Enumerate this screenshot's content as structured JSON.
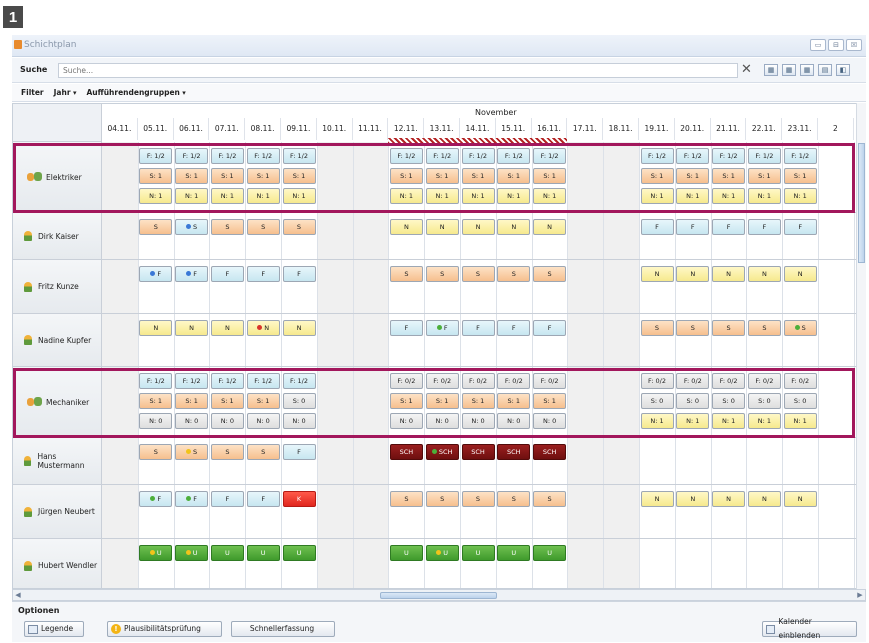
{
  "badge": "1",
  "window": {
    "title": "Schichtplan",
    "buttons": [
      "▭",
      "⊟",
      "☒"
    ]
  },
  "search": {
    "label": "Suche",
    "placeholder": "Suche...",
    "clear": "✕",
    "icons": [
      "▦",
      "▦",
      "▦",
      "▤",
      "◧"
    ]
  },
  "filter": {
    "label": "Filter",
    "year": "Jahr",
    "groups": "Aufführendengruppen"
  },
  "month": "November",
  "days": [
    "04.11.",
    "05.11.",
    "06.11.",
    "07.11.",
    "08.11.",
    "09.11.",
    "10.11.",
    "11.11.",
    "12.11.",
    "13.11.",
    "14.11.",
    "15.11.",
    "16.11.",
    "17.11.",
    "18.11.",
    "19.11.",
    "20.11.",
    "21.11.",
    "22.11.",
    "23.11.",
    "2"
  ],
  "rows": [
    {
      "name": "Elektriker",
      "kind": "group"
    },
    {
      "name": "Dirk Kaiser",
      "kind": "person"
    },
    {
      "name": "Fritz Kunze",
      "kind": "person"
    },
    {
      "name": "Nadine Kupfer",
      "kind": "person"
    },
    {
      "name": "Mechaniker",
      "kind": "group"
    },
    {
      "name": "Hans Mustermann",
      "kind": "person"
    },
    {
      "name": "Jürgen Neubert",
      "kind": "person"
    },
    {
      "name": "Hubert Wendler",
      "kind": "person"
    }
  ],
  "cells": [
    {
      "r": 0,
      "l": 0,
      "d": [
        1,
        2,
        3,
        4,
        5,
        8,
        9,
        10,
        11,
        12,
        15,
        16,
        17,
        18,
        19
      ],
      "t": "F: 1/2",
      "c": "blue"
    },
    {
      "r": 0,
      "l": 1,
      "d": [
        1,
        2,
        3,
        4,
        5,
        8,
        9,
        10,
        11,
        12,
        15,
        16,
        17,
        18,
        19
      ],
      "t": "S: 1",
      "c": "orange"
    },
    {
      "r": 0,
      "l": 2,
      "d": [
        1,
        2,
        3,
        4,
        5,
        8,
        9,
        10,
        11,
        12,
        15,
        16,
        17,
        18,
        19
      ],
      "t": "N: 1",
      "c": "yellow"
    },
    {
      "r": 1,
      "l": 0,
      "d": [
        1,
        3,
        4,
        5
      ],
      "t": "S",
      "c": "orange"
    },
    {
      "r": 1,
      "l": 0,
      "d": [
        2
      ],
      "t": "S",
      "c": "blue",
      "dot": "#3a78d6"
    },
    {
      "r": 1,
      "l": 0,
      "d": [
        8,
        9,
        10,
        11,
        12
      ],
      "t": "N",
      "c": "yellow"
    },
    {
      "r": 1,
      "l": 0,
      "d": [
        15,
        16,
        17,
        18,
        19
      ],
      "t": "F",
      "c": "blue"
    },
    {
      "r": 2,
      "l": 0,
      "d": [
        1,
        2
      ],
      "t": "F",
      "c": "blue",
      "dot": "#3a78d6"
    },
    {
      "r": 2,
      "l": 0,
      "d": [
        3,
        4,
        5
      ],
      "t": "F",
      "c": "blue"
    },
    {
      "r": 2,
      "l": 0,
      "d": [
        8,
        9,
        10,
        11,
        12
      ],
      "t": "S",
      "c": "orange"
    },
    {
      "r": 2,
      "l": 0,
      "d": [
        15,
        16,
        17,
        18,
        19
      ],
      "t": "N",
      "c": "yellow"
    },
    {
      "r": 3,
      "l": 0,
      "d": [
        1,
        2,
        3,
        5
      ],
      "t": "N",
      "c": "yellow"
    },
    {
      "r": 3,
      "l": 0,
      "d": [
        4
      ],
      "t": "N",
      "c": "yellow",
      "dot": "#d9342b"
    },
    {
      "r": 3,
      "l": 0,
      "d": [
        8,
        10,
        11,
        12
      ],
      "t": "F",
      "c": "blue"
    },
    {
      "r": 3,
      "l": 0,
      "d": [
        9
      ],
      "t": "F",
      "c": "blue",
      "dot": "#4caf3a"
    },
    {
      "r": 3,
      "l": 0,
      "d": [
        15,
        16,
        17,
        18
      ],
      "t": "S",
      "c": "orange"
    },
    {
      "r": 3,
      "l": 0,
      "d": [
        19
      ],
      "t": "S",
      "c": "orange",
      "dot": "#4caf3a"
    },
    {
      "r": 4,
      "l": 0,
      "d": [
        1,
        2,
        3,
        4,
        5
      ],
      "t": "F: 1/2",
      "c": "blue"
    },
    {
      "r": 4,
      "l": 0,
      "d": [
        8,
        9,
        10,
        11,
        12
      ],
      "t": "F: 0/2",
      "c": "gray"
    },
    {
      "r": 4,
      "l": 0,
      "d": [
        15,
        16,
        17,
        18,
        19
      ],
      "t": "F: 0/2",
      "c": "gray"
    },
    {
      "r": 4,
      "l": 1,
      "d": [
        1,
        2,
        3,
        4
      ],
      "t": "S: 1",
      "c": "orange"
    },
    {
      "r": 4,
      "l": 1,
      "d": [
        5
      ],
      "t": "S: 0",
      "c": "gray"
    },
    {
      "r": 4,
      "l": 1,
      "d": [
        8,
        9,
        10,
        11,
        12
      ],
      "t": "S: 1",
      "c": "orange"
    },
    {
      "r": 4,
      "l": 1,
      "d": [
        15,
        16,
        17,
        18,
        19
      ],
      "t": "S: 0",
      "c": "gray"
    },
    {
      "r": 4,
      "l": 2,
      "d": [
        1,
        2,
        3,
        4,
        5,
        8,
        9,
        10,
        11,
        12
      ],
      "t": "N: 0",
      "c": "gray"
    },
    {
      "r": 4,
      "l": 2,
      "d": [
        15,
        16,
        17,
        18,
        19
      ],
      "t": "N: 1",
      "c": "yellow"
    },
    {
      "r": 5,
      "l": 0,
      "d": [
        1,
        3,
        4
      ],
      "t": "S",
      "c": "orange"
    },
    {
      "r": 5,
      "l": 0,
      "d": [
        2
      ],
      "t": "S",
      "c": "orange",
      "dot": "#f2c41a"
    },
    {
      "r": 5,
      "l": 0,
      "d": [
        5
      ],
      "t": "F",
      "c": "blue"
    },
    {
      "r": 5,
      "l": 0,
      "d": [
        8,
        10,
        11,
        12
      ],
      "t": "SCH",
      "c": "dark"
    },
    {
      "r": 5,
      "l": 0,
      "d": [
        9
      ],
      "t": "SCH",
      "c": "dark",
      "dot": "#4caf3a"
    },
    {
      "r": 6,
      "l": 0,
      "d": [
        1,
        2
      ],
      "t": "F",
      "c": "blue",
      "dot": "#4caf3a"
    },
    {
      "r": 6,
      "l": 0,
      "d": [
        3,
        4
      ],
      "t": "F",
      "c": "blue"
    },
    {
      "r": 6,
      "l": 0,
      "d": [
        5
      ],
      "t": "K",
      "c": "red"
    },
    {
      "r": 6,
      "l": 0,
      "d": [
        8,
        9,
        10,
        11,
        12
      ],
      "t": "S",
      "c": "orange"
    },
    {
      "r": 6,
      "l": 0,
      "d": [
        15,
        16,
        17,
        18,
        19
      ],
      "t": "N",
      "c": "yellow"
    },
    {
      "r": 7,
      "l": 0,
      "d": [
        1,
        2
      ],
      "t": "U",
      "c": "green",
      "dot": "#f2c41a"
    },
    {
      "r": 7,
      "l": 0,
      "d": [
        3,
        4,
        5
      ],
      "t": "U",
      "c": "green"
    },
    {
      "r": 7,
      "l": 0,
      "d": [
        8,
        10,
        11,
        12
      ],
      "t": "U",
      "c": "green"
    },
    {
      "r": 7,
      "l": 0,
      "d": [
        9
      ],
      "t": "U",
      "c": "green",
      "dot": "#f2c41a"
    }
  ],
  "options": {
    "label": "Optionen",
    "legend": "Legende",
    "check": "Plausibilitätsprüfung",
    "quick": "Schnellerfassung",
    "calendar": "Kalender einblenden"
  },
  "colors": {
    "highlight": "#a2175c",
    "hatch": "#b42424"
  }
}
